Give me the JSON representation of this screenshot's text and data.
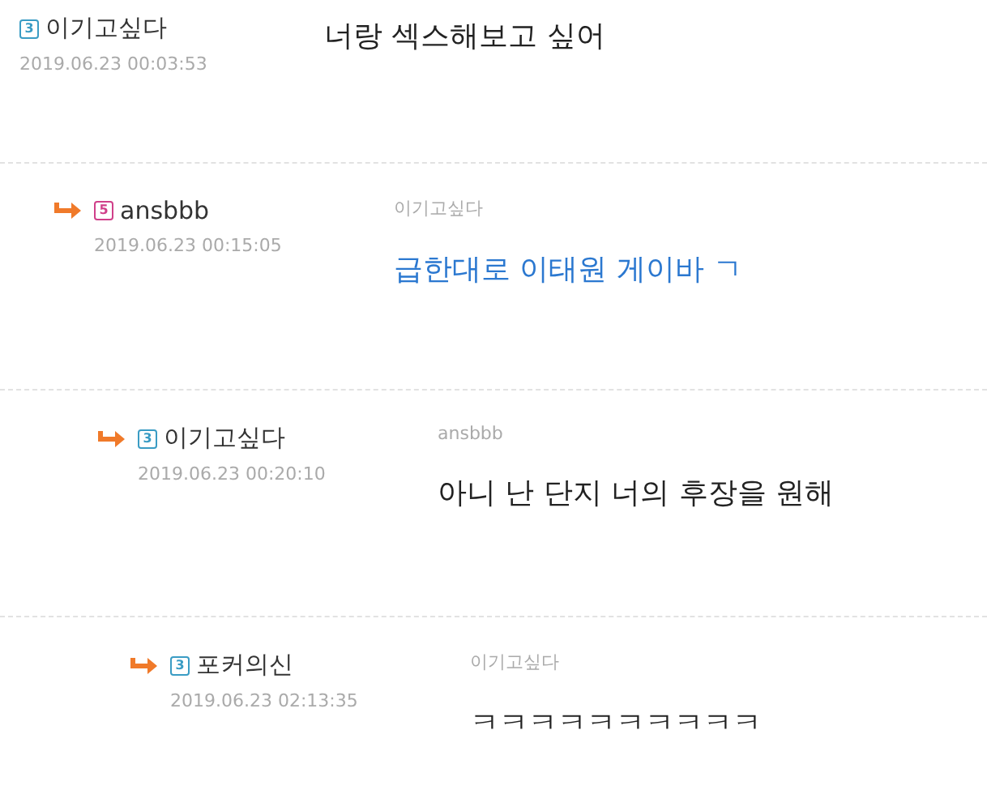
{
  "comments": [
    {
      "badge": {
        "text": "3",
        "color": "#3a9cc4"
      },
      "author": "이기고싶다",
      "date": "2019.06.23 00:03:53",
      "message": "너랑 섹스해보고 싶어",
      "color": "#222222",
      "children": [
        {
          "badge": {
            "text": "5",
            "color": "#d0408a"
          },
          "author": "ansbbb",
          "date": "2019.06.23 00:15:05",
          "reply_to": "이기고싶다",
          "message": "급한대로 이태원 게이바 ㄱ",
          "color": "#2b78d0",
          "children": [
            {
              "badge": {
                "text": "3",
                "color": "#3a9cc4"
              },
              "author": "이기고싶다",
              "date": "2019.06.23 00:20:10",
              "reply_to": "ansbbb",
              "message": "아니 난 단지 너의 후장을 원해",
              "color": "#222222",
              "children": [
                {
                  "badge": {
                    "text": "3",
                    "color": "#3a9cc4"
                  },
                  "author": "포커의신",
                  "date": "2019.06.23 02:13:35",
                  "reply_to": "이기고싶다",
                  "message": "ㅋㅋㅋㅋㅋㅋㅋㅋㅋㅋ",
                  "color": "#222222"
                }
              ]
            }
          ]
        }
      ]
    }
  ]
}
